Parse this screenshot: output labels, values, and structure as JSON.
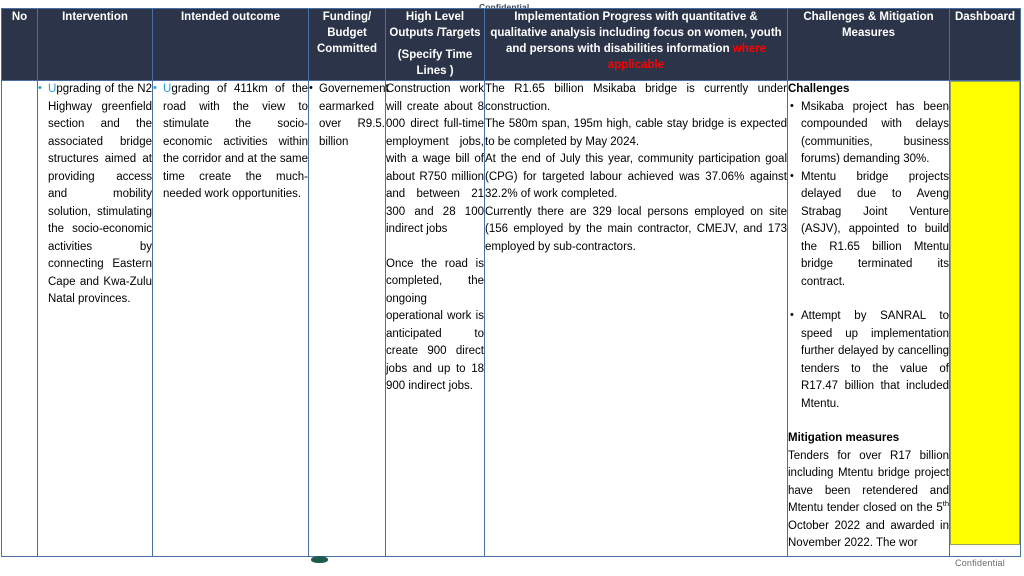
{
  "document": {
    "confidential_top": "Confidential",
    "confidential_bottom": "Confidential"
  },
  "table": {
    "headers": {
      "no": "No",
      "intervention": "Intervention",
      "intended_outcome": "Intended outcome",
      "funding_line1": "Funding/",
      "funding_line2": "Budget",
      "funding_line3": "Committed",
      "outputs_line1": "High Level",
      "outputs_line2": "Outputs /Targets",
      "outputs_line3": "(Specify Time",
      "outputs_line4": "Lines )",
      "progress_main": "Implementation Progress with quantitative & qualitative analysis including focus on women, youth and persons with disabilities information ",
      "progress_red": "where applicable",
      "challenges": "Challenges & Mitigation Measures",
      "dashboard": "Dashboard"
    },
    "row": {
      "no": "",
      "intervention_cap": "U",
      "intervention_rest": "pgrading of the N2 Highway greenfield section and the associated bridge structures aimed at providing access and mobility solution, stimulating the socio-economic activities by connecting Eastern Cape and Kwa-Zulu Natal provinces.",
      "outcome_cap": "U",
      "outcome_rest": "grading of 411km of the road with the view to stimulate the socio-economic activities within the corridor and at the same time create the much-needed work opportunities.",
      "funding": "Governement earmarked over R9.5. billion",
      "outputs_p1": "Construction work will create about 8 000 direct full-time employment jobs, with a wage bill of about R750 million and between 21 300 and 28 100 indirect jobs",
      "outputs_p2": "Once the road is completed, the ongoing operational work is anticipated to create 900 direct jobs and up to 18 900 indirect jobs.",
      "progress_p1": "The R1.65 billion Msikaba bridge is currently under construction.",
      "progress_p2": "The 580m span, 195m high, cable stay bridge is expected to be completed by May 2024.",
      "progress_p3": "At the end of July this year, community participation goal (CPG) for targeted labour achieved was 37.06% against 32.2% of work completed.",
      "progress_p4": "Currently there are 329 local persons employed on site (156 employed by the main contractor, CMEJV, and 173 employed by sub-contractors.",
      "challenges_heading": "Challenges",
      "challenges_b1": "Msikaba project has been compounded with delays (communities, business forums) demanding 30%.",
      "challenges_b2": "Mtentu bridge projects delayed due to Aveng Strabag Joint Venture (ASJV), appointed to build the R1.65 billion Mtentu bridge terminated its contract.",
      "challenges_b3": "Attempt by SANRAL to speed up implementation further delayed by cancelling tenders to the value of R17.47 billion that included Mtentu.",
      "mitigation_heading": "Mitigation measures",
      "mitigation_text_a": "Tenders for over R17 billion including Mtentu bridge project have been retendered and Mtentu tender closed on the 5",
      "mitigation_sup": "th",
      "mitigation_text_b": " October 2022 and awarded in November 2022. The wor"
    }
  },
  "colors": {
    "header_bg": "#2b3449",
    "grid_border": "#4a6fa5",
    "accent_red": "#ff0000",
    "bullet_blue": "#1f9fe0",
    "dashboard_yellow": "#ffff00"
  }
}
